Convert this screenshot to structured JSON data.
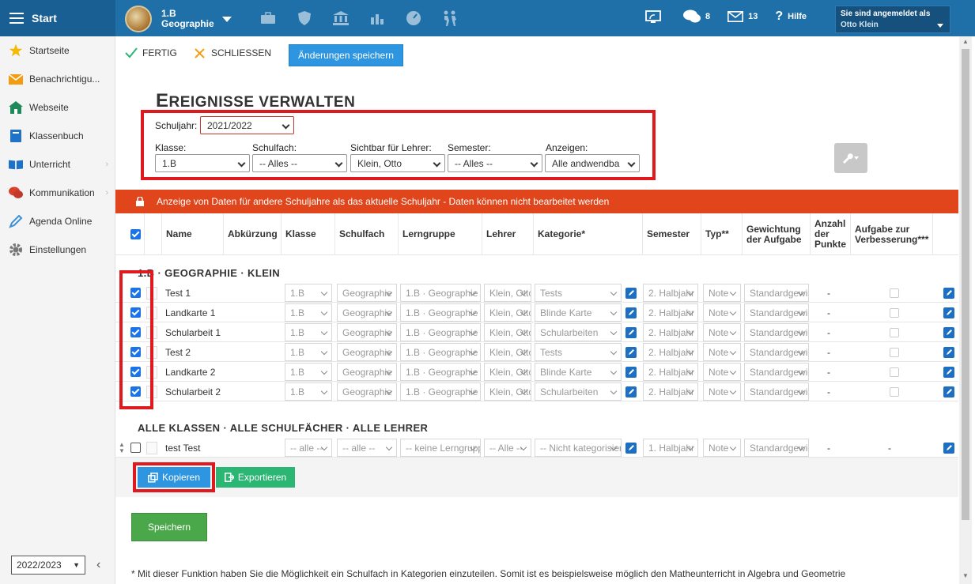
{
  "topbar": {
    "start_label": "Start",
    "class_line1": "1.B",
    "class_line2": "Geographie",
    "messages_count": "8",
    "mail_count": "13",
    "help_label": "Hilfe",
    "logged_in_label": "Sie sind angemeldet als",
    "user_name": "Otto Klein"
  },
  "sidebar": {
    "items": [
      {
        "label": "Startseite",
        "icon": "star-icon"
      },
      {
        "label": "Benachrichtigu...",
        "icon": "envelope-icon"
      },
      {
        "label": "Webseite",
        "icon": "home-icon"
      },
      {
        "label": "Klassenbuch",
        "icon": "book-icon"
      },
      {
        "label": "Unterricht",
        "icon": "open-book-icon"
      },
      {
        "label": "Kommunikation",
        "icon": "chat-icon"
      },
      {
        "label": "Agenda Online",
        "icon": "pen-icon"
      },
      {
        "label": "Einstellungen",
        "icon": "gear-icon"
      }
    ],
    "year": "2022/2023"
  },
  "toolbar": {
    "done_label": "FERTIG",
    "close_label": "SCHLIESSEN",
    "save_changes_label": "Änderungen speichern"
  },
  "page": {
    "title_first": "E",
    "title_rest": "REIGNISSE VERWALTEN"
  },
  "filters": {
    "schuljahr_label": "Schuljahr:",
    "schuljahr_value": "2021/2022",
    "klasse_label": "Klasse:",
    "klasse_value": "1.B",
    "schulfach_label": "Schulfach:",
    "schulfach_value": "-- Alles --",
    "lehrer_label": "Sichtbar für Lehrer:",
    "lehrer_value": "Klein, Otto",
    "semester_label": "Semester:",
    "semester_value": "-- Alles --",
    "anzeigen_label": "Anzeigen:",
    "anzeigen_value": "Alle andwendba"
  },
  "alert": "Anzeige von Daten für andere Schuljahre als das aktuelle Schuljahr - Daten können nicht bearbeitet werden",
  "table": {
    "headers": {
      "name": "Name",
      "abk": "Abkürzung",
      "klasse": "Klasse",
      "schulfach": "Schulfach",
      "lerngruppe": "Lerngruppe",
      "lehrer": "Lehrer",
      "kategorie": "Kategorie*",
      "semester": "Semester",
      "typ": "Typ**",
      "gewichtung": "Gewichtung der Aufgabe",
      "anzahl": "Anzahl der Punkte",
      "aufgabe": "Aufgabe zur Verbesserung***"
    },
    "section1": "1.B · GEOGRAPHIE · KLEIN",
    "rows1": [
      {
        "name": "Test 1",
        "klasse": "1.B",
        "schulfach": "Geographie",
        "lerngruppe": "1.B · Geographie",
        "lehrer": "Klein, Otto",
        "kategorie": "Tests",
        "semester": "2. Halbjahr",
        "typ": "Note",
        "gewichtung": "Standardgewicht",
        "punkte": "-"
      },
      {
        "name": "Landkarte 1",
        "klasse": "1.B",
        "schulfach": "Geographie",
        "lerngruppe": "1.B · Geographie",
        "lehrer": "Klein, Otto",
        "kategorie": "Blinde Karte",
        "semester": "2. Halbjahr",
        "typ": "Note",
        "gewichtung": "Standardgewicht",
        "punkte": "-"
      },
      {
        "name": "Schularbeit 1",
        "klasse": "1.B",
        "schulfach": "Geographie",
        "lerngruppe": "1.B · Geographie",
        "lehrer": "Klein, Otto",
        "kategorie": "Schularbeiten",
        "semester": "2. Halbjahr",
        "typ": "Note",
        "gewichtung": "Standardgewicht",
        "punkte": "-"
      },
      {
        "name": "Test 2",
        "klasse": "1.B",
        "schulfach": "Geographie",
        "lerngruppe": "1.B · Geographie",
        "lehrer": "Klein, Otto",
        "kategorie": "Tests",
        "semester": "2. Halbjahr",
        "typ": "Note",
        "gewichtung": "Standardgewicht",
        "punkte": "-"
      },
      {
        "name": "Landkarte 2",
        "klasse": "1.B",
        "schulfach": "Geographie",
        "lerngruppe": "1.B · Geographie",
        "lehrer": "Klein, Otto",
        "kategorie": "Blinde Karte",
        "semester": "2. Halbjahr",
        "typ": "Note",
        "gewichtung": "Standardgewicht",
        "punkte": "-"
      },
      {
        "name": "Schularbeit 2",
        "klasse": "1.B",
        "schulfach": "Geographie",
        "lerngruppe": "1.B · Geographie",
        "lehrer": "Klein, Otto",
        "kategorie": "Schularbeiten",
        "semester": "2. Halbjahr",
        "typ": "Note",
        "gewichtung": "Standardgewicht",
        "punkte": "-"
      }
    ],
    "section2": "ALLE KLASSEN · ALLE SCHULFÄCHER · ALLE LEHRER",
    "rows2": [
      {
        "name": "test Test",
        "klasse": "-- alle --",
        "schulfach": "-- alle --",
        "lerngruppe": "-- keine Lerngruppe --",
        "lehrer": "-- Alle --",
        "kategorie": "-- Nicht kategorisiert --",
        "semester": "1. Halbjahr",
        "typ": "Note",
        "gewichtung": "Standardgewicht",
        "punkte": "-",
        "aufgabe": "-"
      }
    ]
  },
  "actions": {
    "copy_label": "Kopieren",
    "export_label": "Exportieren",
    "save_label": "Speichern"
  },
  "footnote": "*   Mit dieser Funktion haben Sie die Möglichkeit ein Schulfach in Kategorien einzuteilen. Somit ist es beispielsweise möglich den Matheunterricht in Algebra und Geometrie",
  "colors": {
    "topbar": "#1f6fa8",
    "alert": "#e0451b",
    "primary": "#2e96e0",
    "success": "#2bb673",
    "save": "#4aa84a",
    "annotation": "#e0191f"
  }
}
